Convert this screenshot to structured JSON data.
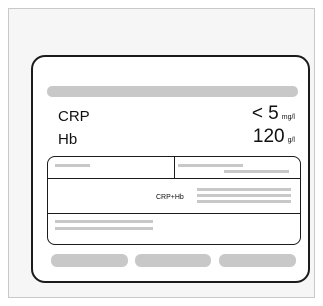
{
  "results": {
    "crp": {
      "label": "CRP",
      "value": "< 5",
      "unit": "mg/l"
    },
    "hb": {
      "label": "Hb",
      "value": "120",
      "unit": "g/l"
    }
  },
  "panel": {
    "combined_label": "CRP+Hb"
  },
  "colors": {
    "placeholder": "#c8c8c8",
    "outline": "#1b1b1b"
  }
}
